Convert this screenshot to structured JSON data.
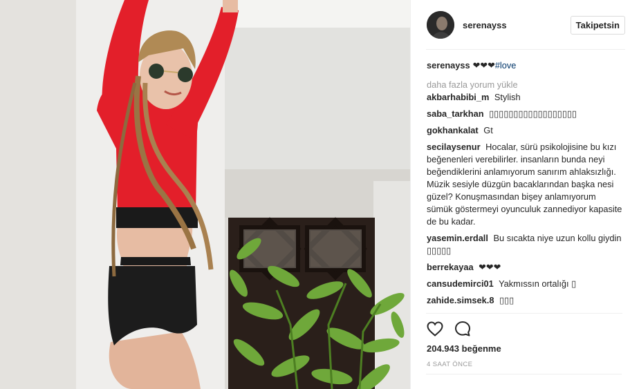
{
  "post": {
    "author": "serenayss",
    "follow_button": "Takipetsin"
  },
  "caption": {
    "user": "serenayss",
    "text": "❤❤❤",
    "hashtag": "#love"
  },
  "load_more": "daha fazla yorum yükle",
  "comments": [
    {
      "user": "akbarhabibi_m",
      "text": "Stylish"
    },
    {
      "user": "saba_tarkhan",
      "text": "▯▯▯▯▯▯▯▯▯▯▯▯▯▯▯▯▯▯"
    },
    {
      "user": "gokhankalat",
      "text": "Gt"
    },
    {
      "user": "secilaysenur",
      "text": "Hocalar, sürü psikolojisine bu kızı beğenenleri verebilirler. insanların bunda neyi beğendiklerini anlamıyorum sanırım ahlaksızlığı. Müzik sesiyle düzgün bacaklarından başka nesi güzel? Konuşmasından bişey anlamıyorum sümük göstermeyi oyunculuk zannediyor kapasite de bu kadar."
    },
    {
      "user": "yasemin.erdall",
      "text": "Bu sıcakta niye uzun kollu giydin ▯▯▯▯▯"
    },
    {
      "user": "berrekayaa",
      "text": "❤❤❤"
    },
    {
      "user": "cansudemirci01",
      "text": "Yakmıssın ortalığı ▯"
    },
    {
      "user": "zahide.simsek.8",
      "text": "▯▯▯"
    }
  ],
  "likes": "204.943 beğenme",
  "time": "4 SAAT ÖNCE",
  "icons": {
    "like": "heart-icon",
    "comment": "comment-icon"
  },
  "colors": {
    "hashtag": "#003569",
    "muted": "#999999",
    "text": "#262626"
  }
}
